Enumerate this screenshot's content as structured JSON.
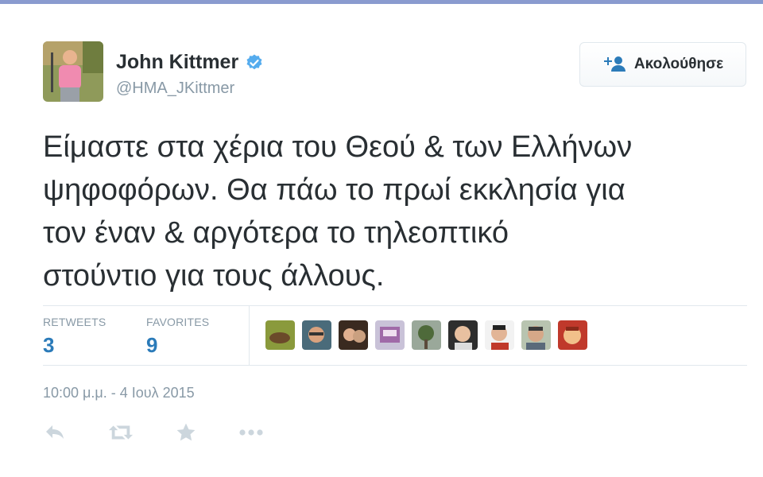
{
  "user": {
    "fullname": "John Kittmer",
    "screen_name": "@HMA_JKittmer",
    "verified_icon": "verified-badge-icon",
    "avatar_icon": "profile-avatar"
  },
  "follow_button": {
    "label": "Ακολούθησε",
    "icon": "add-user-icon"
  },
  "tweet": {
    "lines": [
      "Είμαστε στα χέρια του Θεού & των Ελλήνων",
      "ψηφοφόρων. Θα πάω το πρωί εκκλησία για",
      "τον έναν & αργότερα το τηλεοπτικό",
      "στούντιο για τους άλλους."
    ]
  },
  "stats": {
    "retweets_label": "RETWEETS",
    "retweets_value": "3",
    "favorites_label": "FAVORITES",
    "favorites_value": "9"
  },
  "favoriter_avatar_count_shown": 9,
  "timestamp": "10:00 μ.μ. - 4 Ιουλ 2015",
  "actions": [
    "reply-icon",
    "retweet-icon",
    "favorite-star-icon",
    "more-dots-icon"
  ],
  "colors": {
    "link_blue": "#2b7bb9",
    "muted": "#8899a6",
    "verified_blue": "#55acee",
    "border": "#e1e8ed",
    "top_strip": "#8a9bcf"
  }
}
